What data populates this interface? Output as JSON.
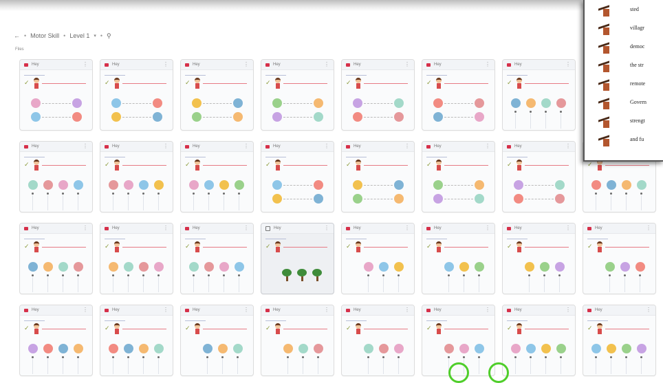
{
  "breadcrumb": {
    "back_icon": "back-arrow-icon",
    "separator": "•",
    "items": [
      "Motor Skill",
      "Level 1"
    ],
    "pin_icon": "pin-icon"
  },
  "files_label": "Files",
  "cards": [
    {
      "name": "Hey",
      "kind": "pairs"
    },
    {
      "name": "Hey",
      "kind": "pairs"
    },
    {
      "name": "Hey",
      "kind": "pairs"
    },
    {
      "name": "Hey",
      "kind": "pairs"
    },
    {
      "name": "Hey",
      "kind": "pairs"
    },
    {
      "name": "Hey",
      "kind": "pairs"
    },
    {
      "name": "Hey",
      "kind": "row4"
    },
    {
      "name": "",
      "kind": "hidden"
    },
    {
      "name": "Hey",
      "kind": "row4"
    },
    {
      "name": "Hey",
      "kind": "row4"
    },
    {
      "name": "Hey",
      "kind": "row4"
    },
    {
      "name": "Hey",
      "kind": "pairs"
    },
    {
      "name": "Hey",
      "kind": "pairs"
    },
    {
      "name": "Hey",
      "kind": "pairs"
    },
    {
      "name": "Hey",
      "kind": "pairs"
    },
    {
      "name": "",
      "kind": "row4"
    },
    {
      "name": "Hey",
      "kind": "row4"
    },
    {
      "name": "Hey",
      "kind": "row4"
    },
    {
      "name": "Hey",
      "kind": "row4"
    },
    {
      "name": "Hey",
      "kind": "trees",
      "selected": true
    },
    {
      "name": "Hey",
      "kind": "row3"
    },
    {
      "name": "Hey",
      "kind": "row3"
    },
    {
      "name": "Hey",
      "kind": "row3"
    },
    {
      "name": "Hey",
      "kind": "row3"
    },
    {
      "name": "Hey",
      "kind": "row4"
    },
    {
      "name": "Hey",
      "kind": "row4"
    },
    {
      "name": "Hey",
      "kind": "row3"
    },
    {
      "name": "Hey",
      "kind": "row3"
    },
    {
      "name": "Hey",
      "kind": "row3"
    },
    {
      "name": "Hey",
      "kind": "row3"
    },
    {
      "name": "Hey",
      "kind": "row4"
    },
    {
      "name": "Hey",
      "kind": "row4"
    }
  ],
  "document": {
    "lines": [
      "sted",
      "villagr",
      "democ",
      "the str",
      "remote",
      "Govern",
      "strengt",
      "and fu"
    ]
  },
  "colors": {
    "accent_red": "#d6304a",
    "ring_green": "#4fce2a",
    "icon_brown": "#b3562e"
  }
}
